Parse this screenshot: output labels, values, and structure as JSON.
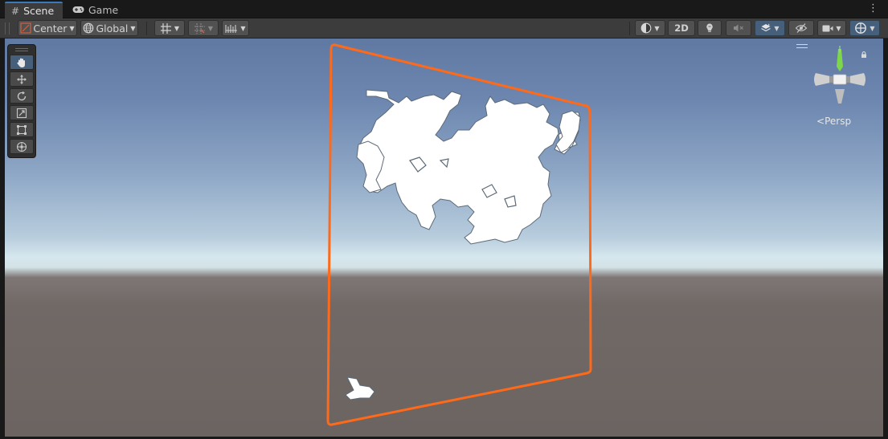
{
  "tabs": [
    {
      "label": "Scene",
      "icon": "hash-grid-icon",
      "active": true
    },
    {
      "label": "Game",
      "icon": "gamepad-icon",
      "active": false
    }
  ],
  "toolbar": {
    "pivot_mode": "Center",
    "pivot_rotation": "Global",
    "mode_2d_label": "2D"
  },
  "tools": [
    "hand-tool",
    "move-tool",
    "rotate-tool",
    "scale-tool",
    "rect-tool",
    "transform-tool"
  ],
  "gizmo": {
    "projection_label": "Persp"
  },
  "colors": {
    "selection_outline": "#ff6a1a",
    "accent_blue": "#46607c",
    "gizmo_y": "#7ed64b"
  }
}
